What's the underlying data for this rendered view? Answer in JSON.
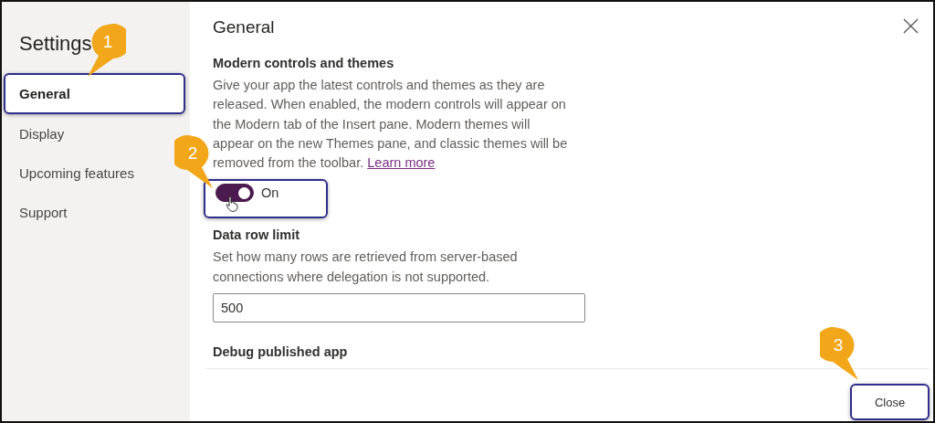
{
  "sidebar": {
    "title": "Settings",
    "items": [
      {
        "label": "General",
        "selected": true,
        "highlighted": true,
        "callout": "1"
      },
      {
        "label": "Display",
        "selected": false,
        "highlighted": false
      },
      {
        "label": "Upcoming features",
        "selected": false,
        "highlighted": false
      },
      {
        "label": "Support",
        "selected": false,
        "highlighted": false
      }
    ]
  },
  "page_title": "General",
  "sections": [
    {
      "kind": "toggle",
      "heading": "Modern controls and themes",
      "description": "Give your app the latest controls and themes as they are released. When enabled, the modern controls will appear on the Modern tab of the Insert pane. Modern themes will appear on the new Themes pane, and classic themes will be removed from the toolbar.",
      "link": "Learn more",
      "on": true,
      "state_label": "On",
      "highlighted": true,
      "callout": "2"
    },
    {
      "kind": "number",
      "heading": "Data row limit",
      "description": "Set how many rows are retrieved from server-based connections where delegation is not supported.",
      "value": "500"
    },
    {
      "kind": "heading",
      "heading": "Debug published app"
    }
  ],
  "close_button": {
    "label": "Close",
    "highlighted": true,
    "callout": "3"
  }
}
